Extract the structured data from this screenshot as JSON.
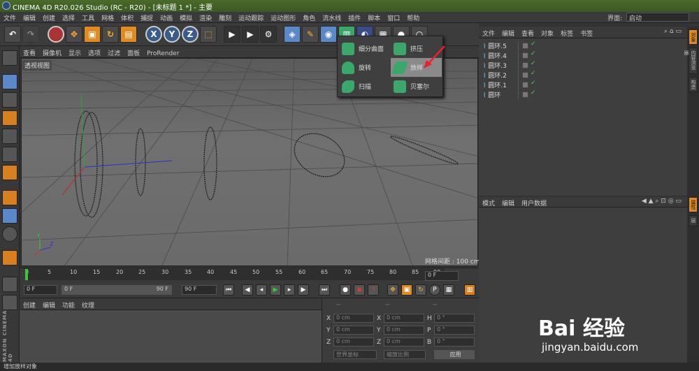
{
  "window": {
    "title": "CINEMA 4D R20.026 Studio (RC - R20) - [未标题 1 *] - 主要"
  },
  "menu": {
    "items": [
      "文件",
      "编辑",
      "创建",
      "选择",
      "工具",
      "网格",
      "体积",
      "捕捉",
      "动画",
      "模拟",
      "渲染",
      "雕刻",
      "运动跟踪",
      "运动图形",
      "角色",
      "流水线",
      "插件",
      "脚本",
      "窗口",
      "帮助"
    ],
    "interface_label": "界面:",
    "interface_value": "启动"
  },
  "toolbar": {
    "axis_x": "X",
    "axis_y": "Y",
    "axis_z": "Z"
  },
  "viewport": {
    "menu": [
      "查看",
      "摄像机",
      "显示",
      "选项",
      "过滤",
      "面板",
      "ProRender"
    ],
    "label": "透视视图",
    "grid_label": "网格间距 : 100 cm",
    "axis_y": "Y",
    "axis_z": "Z"
  },
  "popup": {
    "items": [
      {
        "label": "细分曲面",
        "icon": "subdivision-surface-icon",
        "color": "#3aa86a"
      },
      {
        "label": "挤压",
        "icon": "extrude-icon",
        "color": "#3aa86a"
      },
      {
        "label": "旋转",
        "icon": "lathe-icon",
        "color": "#3aa86a"
      },
      {
        "label": "放样",
        "icon": "loft-icon",
        "color": "#3aa86a",
        "highlighted": true
      },
      {
        "label": "扫描",
        "icon": "sweep-icon",
        "color": "#3aa86a"
      },
      {
        "label": "贝塞尔",
        "icon": "bezier-icon",
        "color": "#3aa86a"
      }
    ]
  },
  "timeline": {
    "ticks": [
      "0",
      "5",
      "10",
      "15",
      "20",
      "25",
      "30",
      "35",
      "40",
      "45",
      "50",
      "55",
      "60",
      "65",
      "70",
      "75",
      "80",
      "85",
      "90"
    ],
    "end_field": "0 F"
  },
  "playbar": {
    "start": "0 F",
    "range_start": "0 F",
    "range_end": "90 F",
    "end": "90 F"
  },
  "material": {
    "menu": [
      "创建",
      "编辑",
      "功能",
      "纹理"
    ]
  },
  "coords": {
    "headers": [
      "--",
      "--",
      "--"
    ],
    "rows": [
      {
        "a": "X",
        "av": "0 cm",
        "b": "X",
        "bv": "0 cm",
        "c": "H",
        "cv": "0 °"
      },
      {
        "a": "Y",
        "av": "0 cm",
        "b": "Y",
        "bv": "0 cm",
        "c": "P",
        "cv": "0 °"
      },
      {
        "a": "Z",
        "av": "0 cm",
        "b": "Z",
        "bv": "0 cm",
        "c": "B",
        "cv": "0 °"
      }
    ],
    "world": "世界坐标",
    "scale": "缩放比例",
    "apply": "应用"
  },
  "objects": {
    "menu": [
      "文件",
      "编辑",
      "查看",
      "对象",
      "标签",
      "书签"
    ],
    "items": [
      "圆环.5",
      "圆环.4",
      "圆环.3",
      "圆环.2",
      "圆环.1",
      "圆环"
    ]
  },
  "attributes": {
    "menu": [
      "模式",
      "编辑",
      "用户数据"
    ]
  },
  "right_tabs": [
    "对象",
    "内容浏览器",
    "构造",
    "属性",
    "层"
  ],
  "watermark": {
    "brand": "Bai 经验",
    "url": "jingyan.baidu.com"
  },
  "logo": {
    "text": "MAXON CINEMA 4D"
  },
  "status": "增加放样对象",
  "accent": "#e08a20"
}
